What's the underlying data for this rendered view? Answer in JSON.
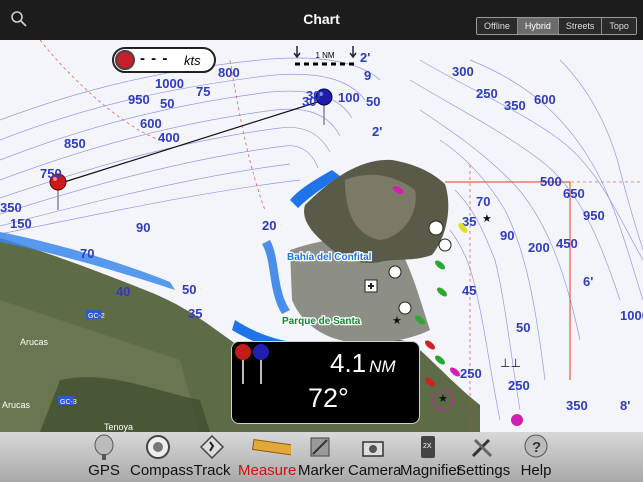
{
  "header": {
    "title": "Chart",
    "map_modes": [
      "Offline",
      "Hybrid",
      "Streets",
      "Topo"
    ],
    "active_map_mode": "Hybrid"
  },
  "speed": {
    "value": "- - -",
    "unit": "kts"
  },
  "scale": {
    "label": "1 NM"
  },
  "measure": {
    "distance": "4.1",
    "distance_unit": "NM",
    "bearing": "72°"
  },
  "map_labels": {
    "bay": "Bahía del Confital",
    "park": "Parque de Santa",
    "town_1": "Arucas",
    "town_2": "Arucas",
    "town_3": "Tenoya",
    "road_1": "GC-2",
    "road_2": "GC-3",
    "depth_labels": [
      "50",
      "75",
      "800",
      "30",
      "2'",
      "1000",
      "950",
      "600",
      "400",
      "850",
      "750",
      "350",
      "150",
      "70",
      "90",
      "40",
      "35",
      "50",
      "20",
      "100",
      "50",
      "9",
      "2'",
      "300",
      "250",
      "350",
      "600",
      "950",
      "500",
      "650",
      "200",
      "450",
      "90",
      "70",
      "35",
      "45",
      "50",
      "6'",
      "1000",
      "250",
      "350",
      "250",
      "8'",
      "30"
    ]
  },
  "toolbar": {
    "items": [
      {
        "label": "GPS",
        "icon": "satellite-dish-icon"
      },
      {
        "label": "Compass",
        "icon": "compass-icon"
      },
      {
        "label": "Track",
        "icon": "track-icon"
      },
      {
        "label": "Measure",
        "icon": "ruler-icon"
      },
      {
        "label": "Marker",
        "icon": "marker-icon"
      },
      {
        "label": "Camera",
        "icon": "camera-icon"
      },
      {
        "label": "Magnifier",
        "icon": "magnifier-icon"
      },
      {
        "label": "Settings",
        "icon": "settings-icon"
      },
      {
        "label": "Help",
        "icon": "help-icon"
      }
    ],
    "active": "Measure"
  },
  "colors": {
    "accent_red": "#cc1111",
    "depth_blue": "#2e3bbf",
    "shallow_blue": "#1f74e8",
    "land_dark": "#4b5a3a"
  }
}
